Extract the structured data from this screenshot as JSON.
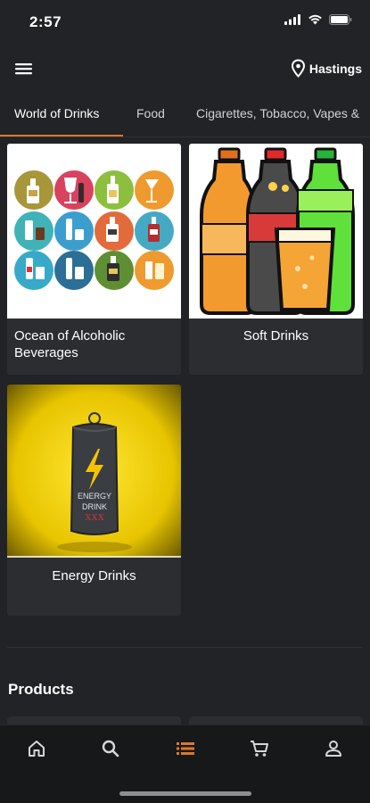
{
  "status_bar": {
    "time": "2:57"
  },
  "header": {
    "menu_icon": "hamburger-menu-icon",
    "location_icon": "map-pin-icon",
    "location": "Hastings"
  },
  "tabs": [
    {
      "label": "World of Drinks",
      "active": true
    },
    {
      "label": "Food",
      "active": false
    },
    {
      "label": "Cigarettes, Tobacco, Vapes &",
      "active": false
    }
  ],
  "categories": [
    {
      "label": "Ocean of Alcoholic Beverages",
      "image": "alcoholic-beverages-collage"
    },
    {
      "label": "Soft Drinks",
      "image": "soft-drink-bottles"
    },
    {
      "label": "Energy Drinks",
      "image": "energy-drink-can"
    }
  ],
  "products": {
    "title": "Products"
  },
  "bottom_nav": [
    {
      "icon": "home-icon",
      "active": false
    },
    {
      "icon": "search-icon",
      "active": false
    },
    {
      "icon": "list-icon",
      "active": true
    },
    {
      "icon": "cart-icon",
      "active": false
    },
    {
      "icon": "user-icon",
      "active": false
    }
  ],
  "colors": {
    "background": "#212326",
    "card": "#2b2d31",
    "accent": "#e0782a",
    "nav_bar": "#17181a"
  }
}
